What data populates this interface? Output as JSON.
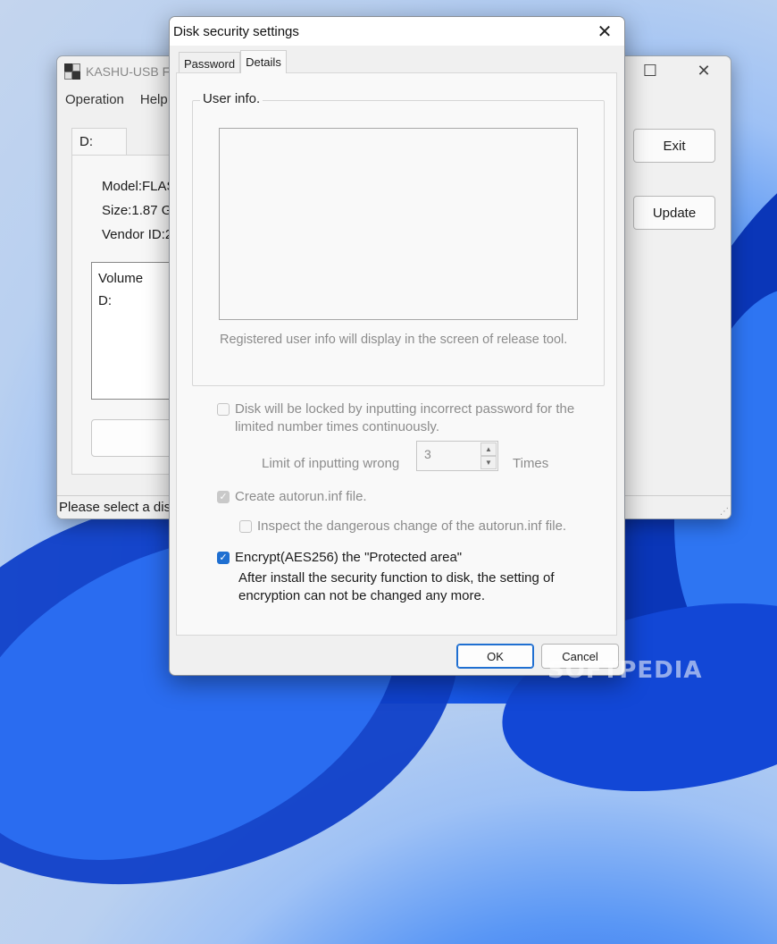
{
  "main_window": {
    "title": "KASHU-USB F",
    "menu": [
      "Operation",
      "Help"
    ],
    "maximize_glyph": "☐",
    "close_glyph": "✕",
    "tab_label": "D:",
    "model": "Model:FLAS",
    "size": "Size:1.87 GE",
    "vendor": "Vendor ID:2",
    "volume_header": "Volume",
    "volume_item": "D:",
    "exit_label": "Exit",
    "update_label": "Update",
    "status": "Please select a disk"
  },
  "dialog": {
    "title": "Disk security settings",
    "close_glyph": "✕",
    "tabs": [
      "Password",
      "Details"
    ],
    "group_label": "User info.",
    "hint": "Registered user info will display in the screen of release tool.",
    "lock_label": "Disk will be locked by inputting incorrect password for the limited number times continuously.",
    "limit_label": "Limit of inputting wrong",
    "limit_value": "3",
    "times_label": "Times",
    "autorun_label": "Create autorun.inf file.",
    "inspect_label": "Inspect the dangerous change of the autorun.inf file.",
    "encrypt_label": "Encrypt(AES256) the \"Protected area\"",
    "encrypt_note": "After install the security function to disk, the setting of encryption can not be changed any more.",
    "ok_label": "OK",
    "cancel_label": "Cancel"
  },
  "watermark": "SOFTPEDIA",
  "colors": {
    "accent": "#1f6fd1",
    "dialog_bg": "#f0f0f0",
    "disabled_text": "#8c8c8c"
  },
  "icons": [
    "app-shield-icon",
    "close-icon",
    "maximize-icon",
    "checkbox-checked-icon",
    "spin-up-icon",
    "spin-down-icon",
    "resize-grip-icon"
  ]
}
